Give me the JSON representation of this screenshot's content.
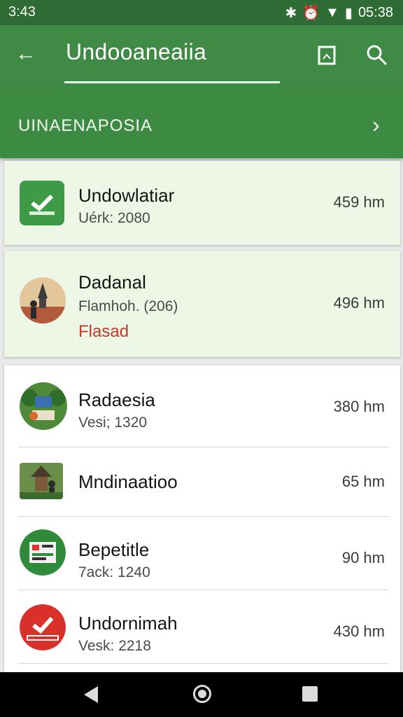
{
  "status_bar": {
    "time": "3:43",
    "clock": "05:38"
  },
  "app_bar": {
    "title": "Undooaneaiia"
  },
  "sub_header": {
    "label": "UINAENAPOSIA"
  },
  "items": [
    {
      "name": "Undowlatiar",
      "sub": "Uérk: 2080",
      "extra": "",
      "dist": "459 hm",
      "icon": "green-check-icon"
    },
    {
      "name": "Dadanal",
      "sub": "Flamhoh. (206)",
      "extra": "Flasad",
      "dist": "496 hm",
      "icon": "tower-avatar-icon"
    },
    {
      "name": "Radaesia",
      "sub": "Vesi; 1320",
      "extra": "",
      "dist": "380 hm",
      "icon": "park-scene-icon"
    },
    {
      "name": "Mndinaatioo",
      "sub": "",
      "extra": "",
      "dist": "65 hm",
      "icon": "pagoda-scene-icon"
    },
    {
      "name": "Bepetitle",
      "sub": "7ack: 1240",
      "extra": "",
      "dist": "90 hm",
      "icon": "green-board-icon"
    },
    {
      "name": "Undornimah",
      "sub": "Vesk: 2218",
      "extra": "",
      "dist": "430 hm",
      "icon": "red-check-icon"
    }
  ],
  "colors": {
    "primary": "#3f8a45",
    "status_bar": "#2f6b34",
    "highlight": "#eef6e6",
    "accent_red": "#c0392b"
  }
}
